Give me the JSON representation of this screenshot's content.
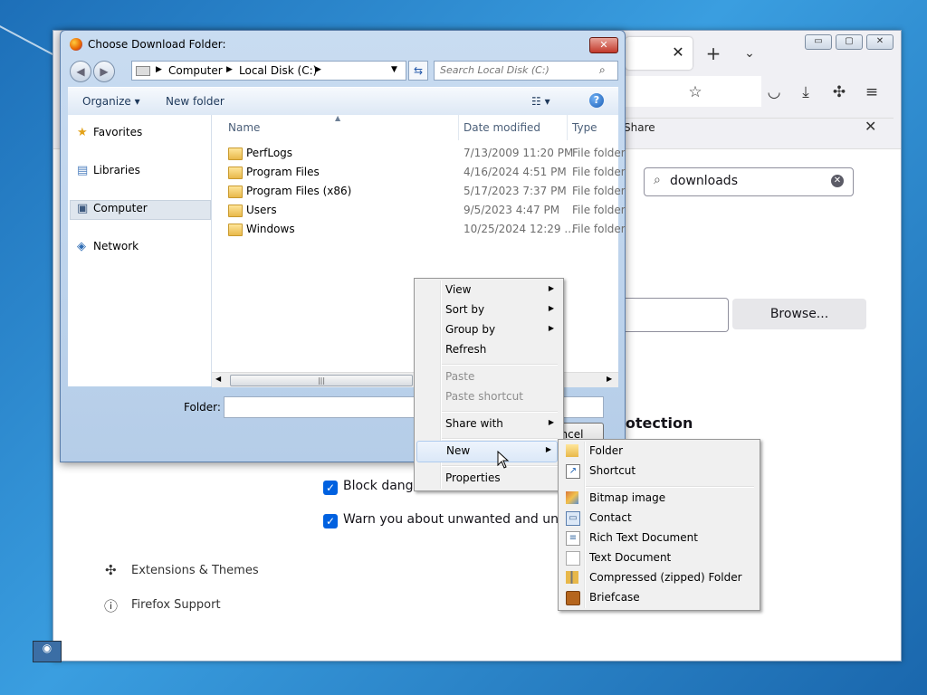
{
  "firefox": {
    "tab_close": "✕",
    "new_tab": "+",
    "tab_list": "⌄",
    "share_label": "Share",
    "find_close": "✕",
    "search_value": "downloads",
    "browse_label": "Browse...",
    "protection_heading": "rotection",
    "checkbox1_label": "Block dange",
    "checkbox2_label": "Warn you about unwanted and unco",
    "ext_link": "Extensions & Themes",
    "support_link": "Firefox Support",
    "window_buttons": {
      "minimize": "▭",
      "maximize": "▢",
      "close": "✕"
    }
  },
  "dialog": {
    "title": "Choose Download Folder:",
    "close": "✕",
    "breadcrumb": [
      "Computer",
      "Local Disk (C:)"
    ],
    "search_placeholder": "Search Local Disk (C:)",
    "organize": "Organize ▾",
    "new_folder": "New folder",
    "views": "☷ ▾",
    "help": "?",
    "nav": {
      "favorites": "Favorites",
      "libraries": "Libraries",
      "computer": "Computer",
      "network": "Network"
    },
    "columns": {
      "name": "Name",
      "date": "Date modified",
      "type": "Type"
    },
    "files": [
      {
        "name": "PerfLogs",
        "date": "7/13/2009 11:20 PM",
        "type": "File folder"
      },
      {
        "name": "Program Files",
        "date": "4/16/2024 4:51 PM",
        "type": "File folder"
      },
      {
        "name": "Program Files (x86)",
        "date": "5/17/2023 7:37 PM",
        "type": "File folder"
      },
      {
        "name": "Users",
        "date": "9/5/2023 4:47 PM",
        "type": "File folder"
      },
      {
        "name": "Windows",
        "date": "10/25/2024 12:29 ...",
        "type": "File folder"
      }
    ],
    "folder_label": "Folder:",
    "cancel_label": "ncel"
  },
  "context_menu": {
    "items": [
      "View",
      "Sort by",
      "Group by",
      "Refresh",
      "Paste",
      "Paste shortcut",
      "Share with",
      "New",
      "Properties"
    ]
  },
  "new_submenu": {
    "items": [
      "Folder",
      "Shortcut",
      "Bitmap image",
      "Contact",
      "Rich Text Document",
      "Text Document",
      "Compressed (zipped) Folder",
      "Briefcase"
    ]
  }
}
